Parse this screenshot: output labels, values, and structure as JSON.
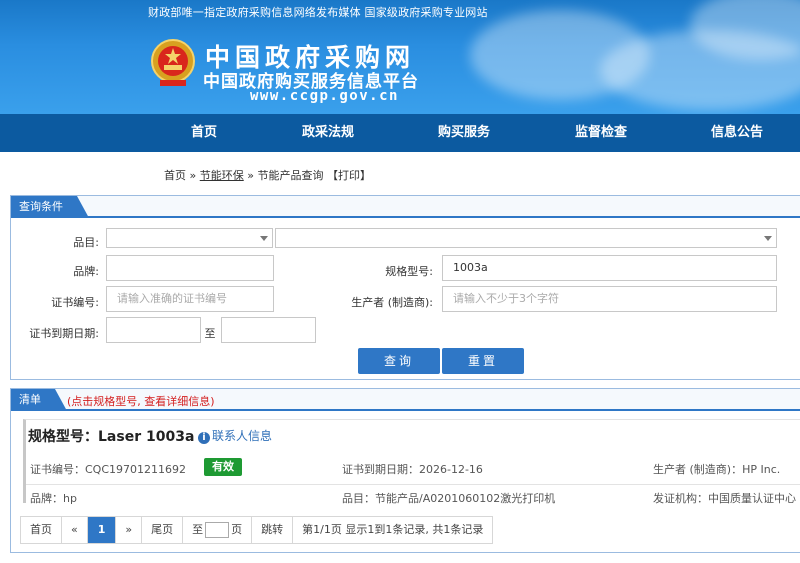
{
  "header": {
    "tagline": "财政部唯一指定政府采购信息网络发布媒体 国家级政府采购专业网站",
    "logo_title": "中国政府采购网",
    "logo_subtitle": "中国政府购买服务信息平台",
    "logo_url": "www.ccgp.gov.cn"
  },
  "nav": [
    {
      "label": "首页"
    },
    {
      "label": "政采法规"
    },
    {
      "label": "购买服务"
    },
    {
      "label": "监督检查"
    },
    {
      "label": "信息公告"
    }
  ],
  "breadcrumb": {
    "home": "首页",
    "sep1": "»",
    "section": "节能环保",
    "sep2": "»",
    "page": "节能产品查询",
    "print": "【打印】"
  },
  "query": {
    "title": "查询条件",
    "category_label": "品目:",
    "brand_label": "品牌:",
    "brand_value": "",
    "model_label": "规格型号:",
    "model_value": "1003a",
    "cert_no_label": "证书编号:",
    "cert_no_placeholder": "请输入准确的证书编号",
    "manufacturer_label": "生产者 (制造商):",
    "manufacturer_placeholder": "请输入不少于3个字符",
    "expiry_label": "证书到期日期:",
    "expiry_to": "至",
    "search_button": "查询",
    "reset_button": "重置"
  },
  "list": {
    "title": "清单",
    "note": "(点击规格型号, 查看详细信息)",
    "items": [
      {
        "model": "规格型号：Laser 1003a",
        "contact": "联系人信息",
        "cert_no": "证书编号：CQC19701211692",
        "status": "有效",
        "expiry": "证书到期日期：2026-12-16",
        "manufacturer": "生产者 (制造商)：HP Inc.",
        "brand": "品牌：hp",
        "category": "品目：节能产品/A0201060102激光打印机",
        "issuer": "发证机构：中国质量认证中心"
      }
    ]
  },
  "pager": {
    "first": "首页",
    "prev": "«",
    "current": "1",
    "next": "»",
    "last": "尾页",
    "goto_prefix": "至",
    "goto_suffix": "页",
    "jump": "跳转",
    "summary": "第1/1页 显示1到1条记录, 共1条记录"
  },
  "colors": {
    "primary": "#2f77c6",
    "nav": "#0c5aa0",
    "valid_badge": "#1e9a33",
    "note_red": "#d42020"
  }
}
